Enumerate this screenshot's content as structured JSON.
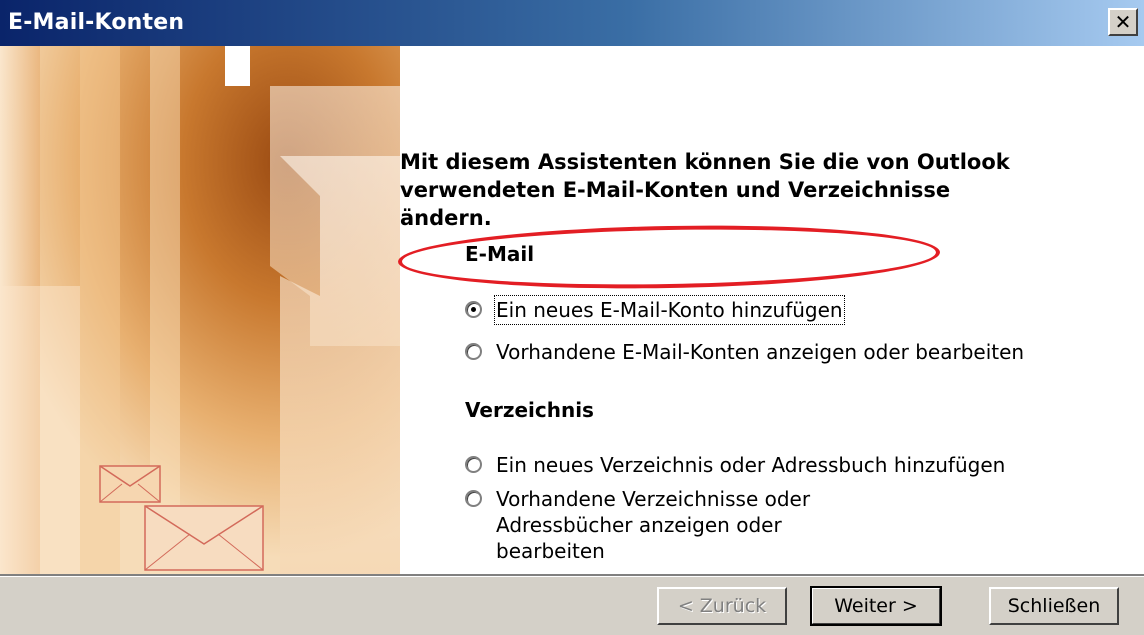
{
  "window": {
    "title": "E-Mail-Konten",
    "close_label": "✕"
  },
  "intro_text": "Mit diesem Assistenten können Sie die von Outlook verwendeten E-Mail-Konten und Verzeichnisse ändern.",
  "email_section": {
    "heading": "E-Mail",
    "options": [
      {
        "label": "Ein neues E-Mail-Konto hinzufügen",
        "checked": true
      },
      {
        "label": "Vorhandene E-Mail-Konten anzeigen oder bearbeiten",
        "checked": false
      }
    ]
  },
  "directory_section": {
    "heading": "Verzeichnis",
    "options": [
      {
        "label": "Ein neues Verzeichnis oder Adressbuch hinzufügen",
        "checked": false
      },
      {
        "label": "Vorhandene Verzeichnisse oder Adressbücher anzeigen oder bearbeiten",
        "checked": false
      }
    ]
  },
  "buttons": {
    "back": "< Zurück",
    "next": "Weiter >",
    "close": "Schließen"
  },
  "colors": {
    "titlebar_start": "#0a246a",
    "titlebar_end": "#a6caf0",
    "highlight": "#e31e24",
    "face": "#d4d0c8"
  }
}
